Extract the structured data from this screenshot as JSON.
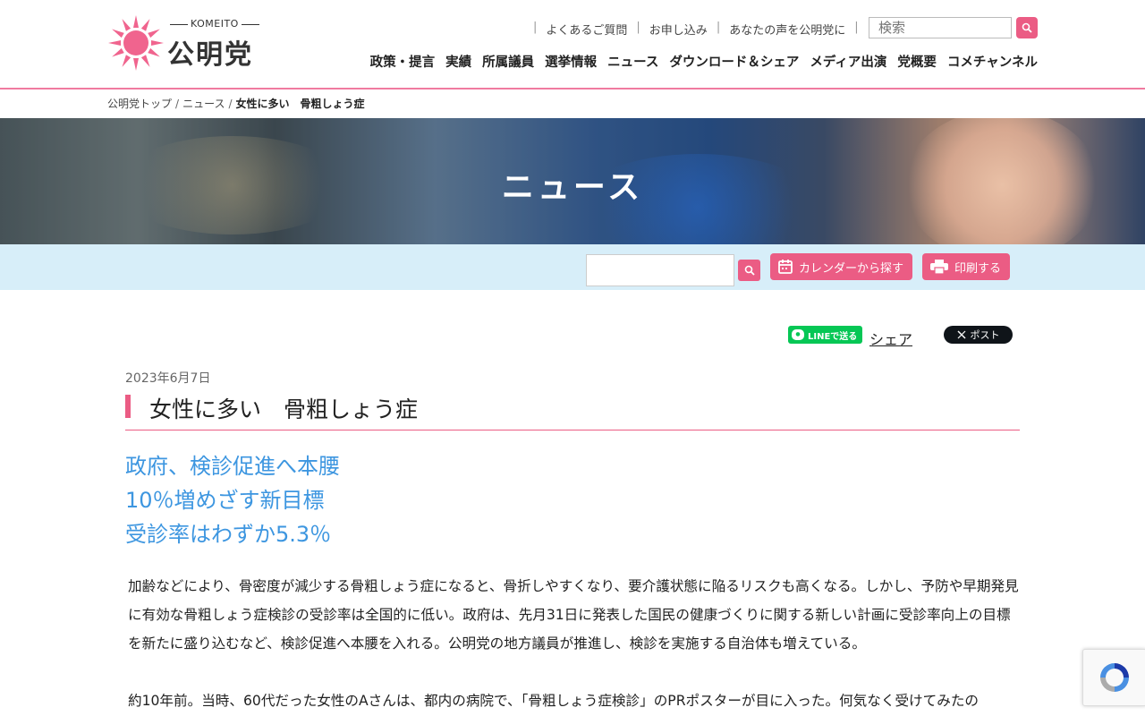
{
  "header": {
    "logo_text_en": "KOMEITO",
    "logo_text_jp": "公明党",
    "util_links": [
      "よくあるご質問",
      "お申し込み",
      "あなたの声を公明党に"
    ],
    "search_placeholder": "検索",
    "nav": [
      "政策・提言",
      "実績",
      "所属議員",
      "選挙情報",
      "ニュース",
      "ダウンロード＆シェア",
      "メディア出演",
      "党概要",
      "コメチャンネル"
    ]
  },
  "breadcrumb": {
    "items": [
      "公明党トップ",
      "ニュース"
    ],
    "current": "女性に多い　骨粗しょう症"
  },
  "hero": {
    "title": "ニュース"
  },
  "toolbar": {
    "calendar_label": "カレンダーから探す",
    "print_label": "印刷する"
  },
  "share": {
    "line_label": "LINEで送る",
    "share_label": "シェア",
    "x_label": "ポスト"
  },
  "article": {
    "date": "2023年6月7日",
    "title": "女性に多い　骨粗しょう症",
    "subheads": [
      "政府、検診促進へ本腰",
      "10％増めざす新目標",
      "受診率はわずか5.3％"
    ],
    "para1": "加齢などにより、骨密度が減少する骨粗しょう症になると、骨折しやすくなり、要介護状態に陥るリスクも高くなる。しかし、予防や早期発見に有効な骨粗しょう症検診の受診率は全国的に低い。政府は、先月31日に発表した国民の健康づくりに関する新しい計画に受診率向上の目標を新たに盛り込むなど、検診促進へ本腰を入れる。公明党の地方議員が推進し、検診を実施する自治体も増えている。",
    "para2": "約10年前。当時、60代だった女性のAさんは、都内の病院で、「骨粗しょう症検診」のPRポスターが目に入った。何気なく受けてみたの"
  },
  "colors": {
    "accent": "#eb5c84",
    "subhead": "#3d96e0",
    "toolbar_bg": "#d7eef9",
    "line": "#06c755"
  }
}
